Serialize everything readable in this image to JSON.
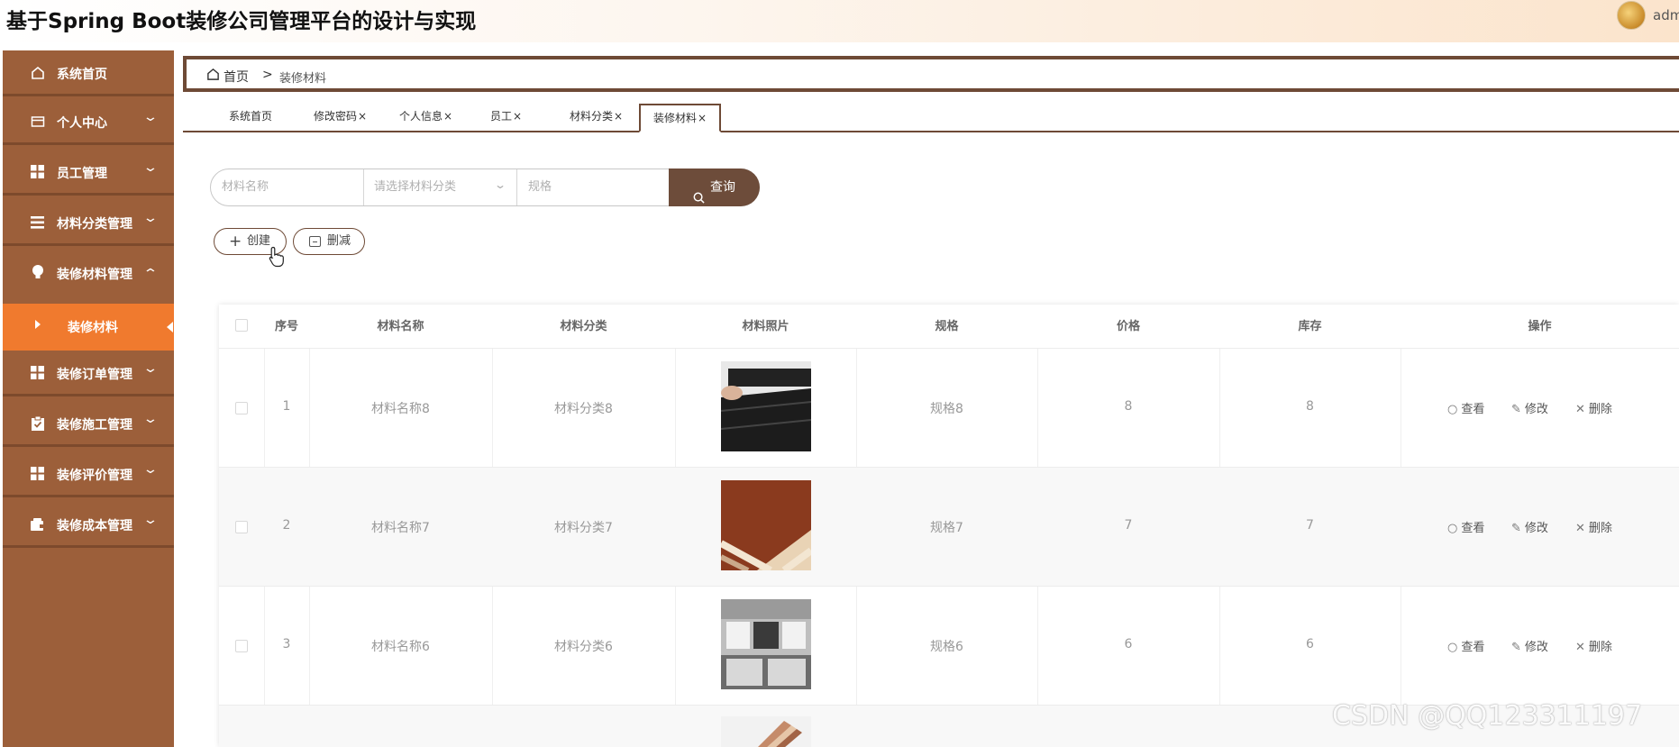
{
  "header": {
    "title": "基于Spring Boot装修公司管理平台的设计与实现",
    "user": "adm"
  },
  "sidebar": {
    "items": [
      {
        "label": "系统首页",
        "icon": "home-icon"
      },
      {
        "label": "个人中心",
        "icon": "card-icon"
      },
      {
        "label": "员工管理",
        "icon": "grid-icon"
      },
      {
        "label": "材料分类管理",
        "icon": "list-icon"
      },
      {
        "label": "装修材料管理",
        "icon": "bulb-icon"
      },
      {
        "label": "装修订单管理",
        "icon": "grid-icon"
      },
      {
        "label": "装修施工管理",
        "icon": "clipboard-icon"
      },
      {
        "label": "装修评价管理",
        "icon": "grid-icon"
      },
      {
        "label": "装修成本管理",
        "icon": "wallet-icon"
      }
    ],
    "sub_item": "装修材料"
  },
  "breadcrumb": {
    "home": "首页",
    "sep": ">",
    "current": "装修材料"
  },
  "tabs": [
    {
      "label": "系统首页",
      "close": ""
    },
    {
      "label": "修改密码",
      "close": "×"
    },
    {
      "label": "个人信息",
      "close": "×"
    },
    {
      "label": "员工",
      "close": "×"
    },
    {
      "label": "材料分类",
      "close": "×"
    },
    {
      "label": "装修材料",
      "close": "×"
    }
  ],
  "search": {
    "name_placeholder": "材料名称",
    "category_placeholder": "请选择材料分类",
    "spec_placeholder": "规格",
    "button": "查询"
  },
  "actions": {
    "create": "创建",
    "delete": "删减"
  },
  "table": {
    "headers": [
      "序号",
      "材料名称",
      "材料分类",
      "材料照片",
      "规格",
      "价格",
      "库存",
      "操作"
    ],
    "rows": [
      {
        "no": "1",
        "name": "材料名称8",
        "category": "材料分类8",
        "spec": "规格8",
        "price": "8",
        "stock": "8"
      },
      {
        "no": "2",
        "name": "材料名称7",
        "category": "材料分类7",
        "spec": "规格7",
        "price": "7",
        "stock": "7"
      },
      {
        "no": "3",
        "name": "材料名称6",
        "category": "材料分类6",
        "spec": "规格6",
        "price": "6",
        "stock": "6"
      }
    ],
    "ops": {
      "view": "查看",
      "edit": "修改",
      "delete": "删除"
    }
  },
  "watermark": "CSDN @QQ123311197",
  "colors": {
    "sidebar": "#9c5f3a",
    "active": "#f07a2e",
    "accent": "#6d4c3a"
  }
}
